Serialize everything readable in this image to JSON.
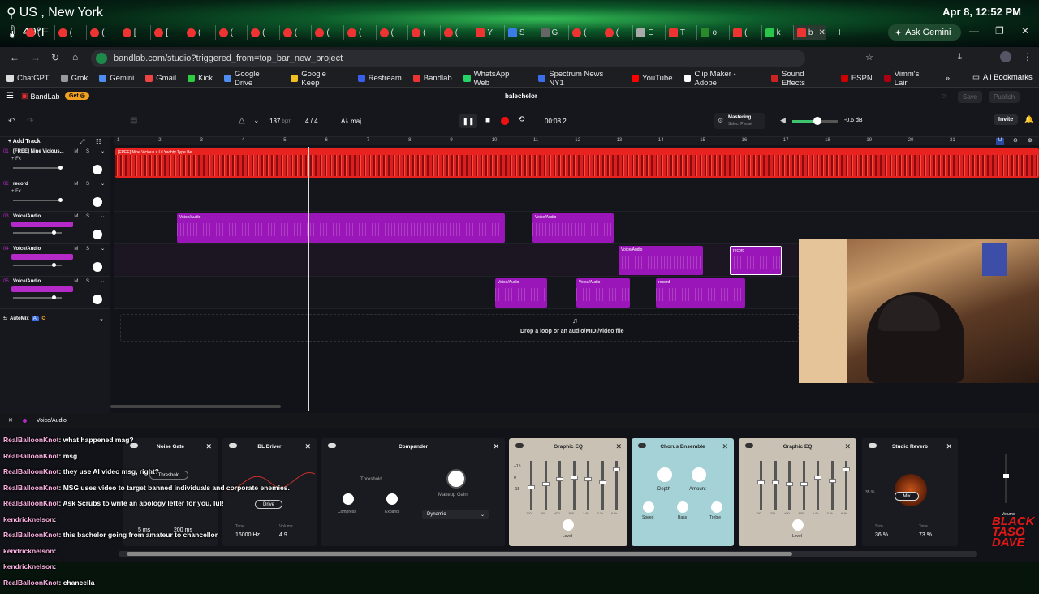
{
  "os": {
    "location": "US , New York",
    "weather": "49°F",
    "datetime": "Apr 8, 12:52 PM"
  },
  "browser": {
    "tabs": [
      "(",
      "(",
      "(",
      "[",
      "[",
      "(",
      "(",
      "(",
      "(",
      "(",
      "(",
      "(",
      "(",
      "(",
      "Y",
      "S",
      "G",
      "(",
      "(",
      "E",
      "T",
      "o",
      "(",
      "k",
      "b"
    ],
    "ask_gemini": "Ask Gemini",
    "new_tab": "+",
    "url": "bandlab.com/studio?triggered_from=top_bar_new_project",
    "bookmarks": [
      "ChatGPT",
      "Grok",
      "Gemini",
      "Gmail",
      "Kick",
      "Google Drive",
      "Google Keep",
      "Restream",
      "Bandlab",
      "WhatsApp Web",
      "Spectrum News NY1",
      "YouTube",
      "Clip Maker - Adobe",
      "Sound Effects",
      "ESPN",
      "Vimm's Lair"
    ],
    "all_bookmarks": "All Bookmarks",
    "colors": {
      "accent": "#1f4a30"
    }
  },
  "daw": {
    "brand": "BandLab",
    "get": "Get ◎",
    "project": "balechelor",
    "save": "Save",
    "publish": "Publish",
    "key_icon": "A♭",
    "key": "maj",
    "bpm": "137",
    "bpm_unit": "bpm",
    "time_sig": "4 / 4",
    "time": "00:08.2",
    "mastering": "Mastering",
    "mastering_sub": "Select Preset",
    "db": "-0.6 dB",
    "invite": "Invite",
    "add_track": "+ Add Track",
    "drop_hint": "Drop a loop or an audio/MIDI/video file",
    "automix": "AutoMix",
    "automix_badge": "AI",
    "ruler": [
      "1",
      "2",
      "3",
      "4",
      "5",
      "6",
      "7",
      "8",
      "9",
      "10",
      "11",
      "12",
      "13",
      "14",
      "15",
      "16",
      "17",
      "18",
      "19",
      "20",
      "21"
    ],
    "tracks": [
      {
        "num": "01",
        "name": "[FREE] Nine Vicious...",
        "fx": "+ Fx"
      },
      {
        "num": "02",
        "name": "record",
        "fx": "+ Fx"
      },
      {
        "num": "03",
        "name": "Voice/Audio"
      },
      {
        "num": "04",
        "name": "Voice/Audio"
      },
      {
        "num": "05",
        "name": "Voice/Audio"
      }
    ],
    "ms": "M S",
    "clips": {
      "beat": "[FREE] Nine Vicious x Lil Yachty Type Be",
      "voice": "Voice/Audio",
      "record": "record"
    }
  },
  "fx": {
    "chain_label": "Voice/Audio",
    "plugins": {
      "noise_gate": {
        "title": "Noise Gate",
        "threshold": "Threshold",
        "presets": "Presets",
        "save": "Save",
        "attack": "5 ms",
        "release": "200 ms"
      },
      "bl_driver": {
        "title": "BL Driver",
        "drive": "Drive",
        "tone_label": "Tone",
        "tone": "16000 Hz",
        "volume_label": "Volume",
        "volume": "4.9"
      },
      "compander": {
        "title": "Compander",
        "threshold": "Threshold",
        "compress": "Compress",
        "expand": "Expand",
        "makeup": "Makeup Gain",
        "mode": "Dynamic"
      },
      "eq1": {
        "title": "Graphic EQ",
        "level": "Level",
        "scale": [
          "+15",
          "0",
          "-15"
        ],
        "bands": [
          "100",
          "200",
          "400",
          "800",
          "1.6k",
          "3.2k",
          "6.4k"
        ]
      },
      "chorus": {
        "title": "Chorus Ensemble",
        "depth": "Depth",
        "amount": "Amount",
        "speed": "Speed",
        "bass": "Bass",
        "treble": "Treble"
      },
      "eq2": {
        "title": "Graphic EQ",
        "level": "Level"
      },
      "reverb": {
        "title": "Studio Reverb",
        "mix": "Mix",
        "pct": "35 %",
        "size_label": "Size",
        "size": "36 %",
        "tone_label": "Tone",
        "tone": "73 %"
      },
      "volume": "Volume"
    }
  },
  "chat": [
    {
      "user": "RealBalloonKnot",
      "msg": "what happened mag?"
    },
    {
      "user": "RealBalloonKnot",
      "msg": "msg"
    },
    {
      "user": "RealBalloonKnot",
      "msg": "they use AI video msg, right?"
    },
    {
      "user": "RealBalloonKnot",
      "msg": "MSG uses video to target banned individuals and corporate enemies."
    },
    {
      "user": "RealBalloonKnot",
      "msg": "Ask Scrubs to write an apology letter for you, lul!"
    },
    {
      "user": "kendricknelson",
      "msg": ""
    },
    {
      "user": "RealBalloonKnot",
      "msg": "this bachelor going from amateur to chancellor"
    },
    {
      "user": "kendricknelson",
      "msg": ""
    },
    {
      "user": "kendricknelson",
      "msg": ""
    },
    {
      "user": "RealBalloonKnot",
      "msg": "chancella"
    }
  ],
  "stream_logo": "BLACK TASO DAVE",
  "colors": {
    "beat": "#e8231f",
    "clip": "#9a16b8",
    "chat_user": "#ffb2e4"
  }
}
